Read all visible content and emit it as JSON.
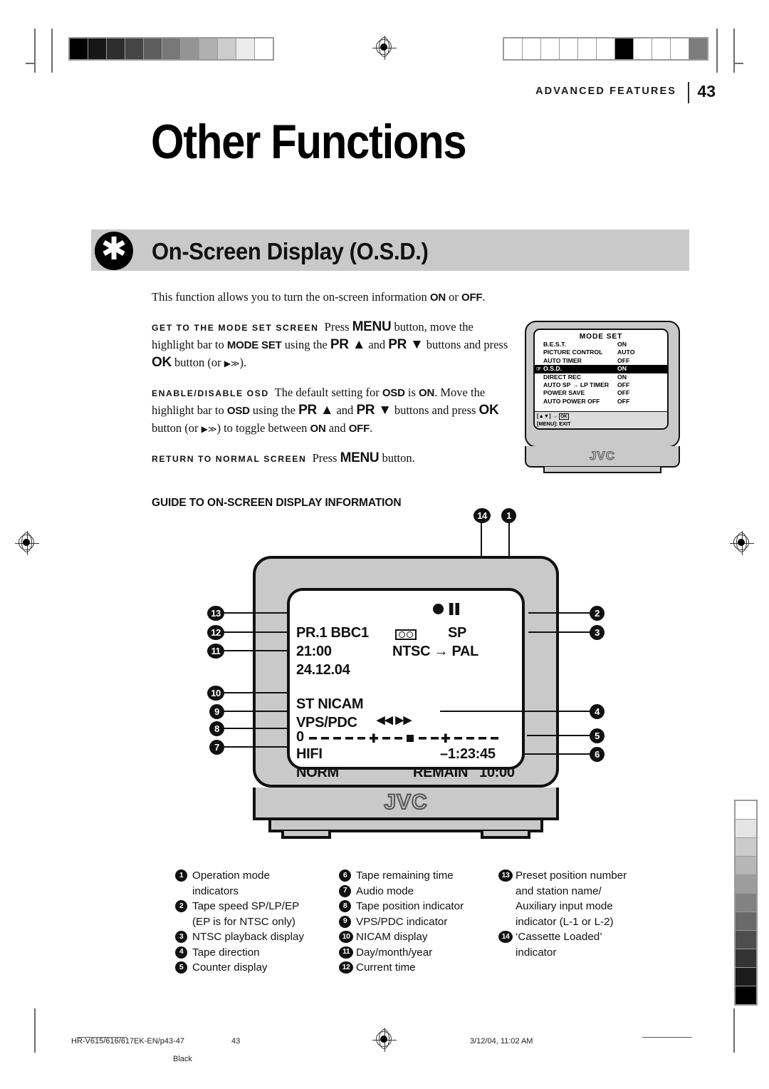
{
  "header": {
    "section_label": "ADVANCED FEATURES",
    "page_number": "43",
    "title": "Other Functions"
  },
  "section": {
    "icon": "asterisk-icon",
    "heading": "On-Screen Display (O.S.D.)"
  },
  "intro": {
    "text_a": "This function allows you to turn the on-screen information ",
    "on": "ON",
    "text_b": " or ",
    "off": "OFF",
    "text_c": "."
  },
  "steps": [
    {
      "lead": "GET TO THE MODE SET SCREEN",
      "parts": [
        "Press ",
        "MENU",
        " button, move the highlight bar to ",
        "MODE SET",
        " using the ",
        "PR ▲",
        " and ",
        "PR ▼",
        " buttons and press ",
        "OK",
        " button (or ",
        "▶≫",
        ")."
      ]
    },
    {
      "lead": "ENABLE/DISABLE OSD",
      "parts": [
        "The default setting for ",
        "OSD",
        " is ",
        "ON",
        ". Move the highlight bar to ",
        "OSD",
        " using the ",
        "PR ▲",
        " and ",
        "PR ▼",
        " buttons and press ",
        "OK",
        " button (or ",
        "▶≫",
        ") to toggle between ",
        "ON",
        " and ",
        "OFF",
        "."
      ]
    },
    {
      "lead": "RETURN TO NORMAL SCREEN",
      "parts": [
        "Press ",
        "MENU",
        " button."
      ]
    }
  ],
  "mode_set_screen": {
    "title": "MODE SET",
    "rows": [
      {
        "label": "B.E.S.T.",
        "value": "ON",
        "highlighted": false
      },
      {
        "label": "PICTURE CONTROL",
        "value": "AUTO",
        "highlighted": false
      },
      {
        "label": "AUTO TIMER",
        "value": "OFF",
        "highlighted": false
      },
      {
        "label": "O.S.D.",
        "value": "ON",
        "highlighted": true
      },
      {
        "label": "DIRECT REC",
        "value": "ON",
        "highlighted": false
      },
      {
        "label": "AUTO SP → LP TIMER",
        "value": "OFF",
        "highlighted": false
      },
      {
        "label": "POWER SAVE",
        "value": "OFF",
        "highlighted": false
      },
      {
        "label": "AUTO POWER OFF",
        "value": "OFF",
        "highlighted": false
      }
    ],
    "footer_line1_prefix": "[",
    "footer_line1_arrows": "▲▼",
    "footer_line1_mid": "] → ",
    "footer_ok": "OK",
    "footer_line2": "[MENU]: EXIT",
    "brand": "JVC"
  },
  "guide": {
    "heading": "GUIDE TO ON-SCREEN DISPLAY INFORMATION",
    "brand": "JVC",
    "osd_display": {
      "preset_station": "PR.1 BBC1",
      "current_time": "21:00",
      "date": "24.12.04",
      "nicam": "ST  NICAM",
      "vps_pdc": "VPS/PDC",
      "counter_zero": "0",
      "audio_mode": "HIFI",
      "norm": "NORM",
      "tape_speed": "SP",
      "ntsc_pal": "NTSC → PAL",
      "direction": "◀◀ ▶▶",
      "counter_value": "–1:23:45",
      "remain_label": "REMAIN",
      "remain_value": "10:00"
    },
    "callouts": [
      "1",
      "2",
      "3",
      "4",
      "5",
      "6",
      "7",
      "8",
      "9",
      "10",
      "11",
      "12",
      "13",
      "14"
    ]
  },
  "legend": {
    "col1": [
      {
        "n": "1",
        "lines": [
          "Operation mode",
          "indicators"
        ]
      },
      {
        "n": "2",
        "lines": [
          "Tape speed SP/LP/EP",
          "(EP is for NTSC only)"
        ]
      },
      {
        "n": "3",
        "lines": [
          "NTSC playback display"
        ]
      },
      {
        "n": "4",
        "lines": [
          "Tape direction"
        ]
      },
      {
        "n": "5",
        "lines": [
          "Counter display"
        ]
      }
    ],
    "col2": [
      {
        "n": "6",
        "lines": [
          "Tape remaining time"
        ]
      },
      {
        "n": "7",
        "lines": [
          "Audio mode"
        ]
      },
      {
        "n": "8",
        "lines": [
          "Tape position indicator"
        ]
      },
      {
        "n": "9",
        "lines": [
          "VPS/PDC indicator"
        ]
      },
      {
        "n": "10",
        "lines": [
          "NICAM display"
        ]
      },
      {
        "n": "11",
        "lines": [
          "Day/month/year"
        ]
      },
      {
        "n": "12",
        "lines": [
          "Current time"
        ]
      }
    ],
    "col3": [
      {
        "n": "13",
        "lines": [
          "Preset position number",
          "and station name/",
          "Auxiliary input mode",
          "indicator (L-1 or L-2)"
        ]
      },
      {
        "n": "14",
        "lines": [
          "‘Cassette Loaded’",
          "indicator"
        ]
      }
    ]
  },
  "footer": {
    "job": "HR-V615/616/617EK-EN/p43-47",
    "page": "43",
    "plate": "Black",
    "timestamp": "3/12/04, 11:02 AM"
  },
  "colors": {
    "band_grey": "#c9c9c9",
    "black": "#111111",
    "menu_footer_grey": "#dcdcdc"
  }
}
